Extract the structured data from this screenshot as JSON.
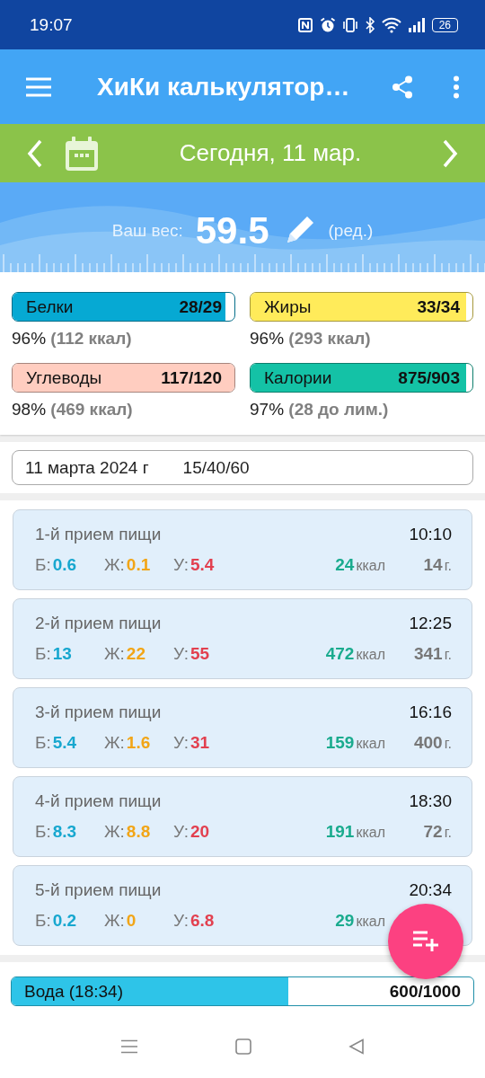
{
  "status_bar": {
    "time": "19:07",
    "battery": "26"
  },
  "app_bar": {
    "title": "ХиКи калькулятор…"
  },
  "date_bar": {
    "label": "Сегодня, 11 мар."
  },
  "weight": {
    "label": "Ваш вес:",
    "value": "59.5",
    "edit": "(ред.)"
  },
  "nutrients": [
    {
      "name": "Белки",
      "value": "28/29",
      "level": 0.96,
      "color": "#06a9d3",
      "summary": "96% **(112 ккал)**"
    },
    {
      "name": "Жиры",
      "value": "33/34",
      "level": 0.97,
      "color": "#ffeb5a",
      "summary": "96% **(293 ккал)**"
    },
    {
      "name": "Углеводы",
      "value": "117/120",
      "level": 1,
      "color": "#ffcdc0",
      "summary": "98% **(469 ккал)**"
    },
    {
      "name": "Калории",
      "value": "875/903",
      "level": 0.97,
      "color": "#14c2a6",
      "summary": "97% **(28 до лим.)**"
    }
  ],
  "day": {
    "date": "11 марта 2024 г",
    "ratio": "15/40/60"
  },
  "meals": [
    {
      "name": "1-й прием пищи",
      "time": "10:10",
      "macros": [
        {
          "label": "Б:",
          "value": "0.6",
          "color": "#17a7cf"
        },
        {
          "label": "Ж:",
          "value": "0.1",
          "color": "#f2a516"
        },
        {
          "label": "У:",
          "value": "5.4",
          "color": "#e2404f"
        }
      ],
      "kcal": "24",
      "kcal_unit": "ккал",
      "weight": "14",
      "weight_unit": "г."
    },
    {
      "name": "2-й прием пищи",
      "time": "12:25",
      "macros": [
        {
          "label": "Б:",
          "value": "13",
          "color": "#17a7cf"
        },
        {
          "label": "Ж:",
          "value": "22",
          "color": "#f2a516"
        },
        {
          "label": "У:",
          "value": "55",
          "color": "#e2404f"
        }
      ],
      "kcal": "472",
      "kcal_unit": "ккал",
      "weight": "341",
      "weight_unit": "г."
    },
    {
      "name": "3-й прием пищи",
      "time": "16:16",
      "macros": [
        {
          "label": "Б:",
          "value": "5.4",
          "color": "#17a7cf"
        },
        {
          "label": "Ж:",
          "value": "1.6",
          "color": "#f2a516"
        },
        {
          "label": "У:",
          "value": "31",
          "color": "#e2404f"
        }
      ],
      "kcal": "159",
      "kcal_unit": "ккал",
      "weight": "400",
      "weight_unit": "г."
    },
    {
      "name": "4-й прием пищи",
      "time": "18:30",
      "macros": [
        {
          "label": "Б:",
          "value": "8.3",
          "color": "#17a7cf"
        },
        {
          "label": "Ж:",
          "value": "8.8",
          "color": "#f2a516"
        },
        {
          "label": "У:",
          "value": "20",
          "color": "#e2404f"
        }
      ],
      "kcal": "191",
      "kcal_unit": "ккал",
      "weight": "72",
      "weight_unit": "г."
    },
    {
      "name": "5-й прием пищи",
      "time": "20:34",
      "macros": [
        {
          "label": "Б:",
          "value": "0.2",
          "color": "#17a7cf"
        },
        {
          "label": "Ж:",
          "value": "0",
          "color": "#f2a516"
        },
        {
          "label": "У:",
          "value": "6.8",
          "color": "#e2404f"
        }
      ],
      "kcal": "29",
      "kcal_unit": "ккал"
    }
  ],
  "water": {
    "label": "Вода (18:34)",
    "value": "600/1000",
    "level": 0.6
  }
}
